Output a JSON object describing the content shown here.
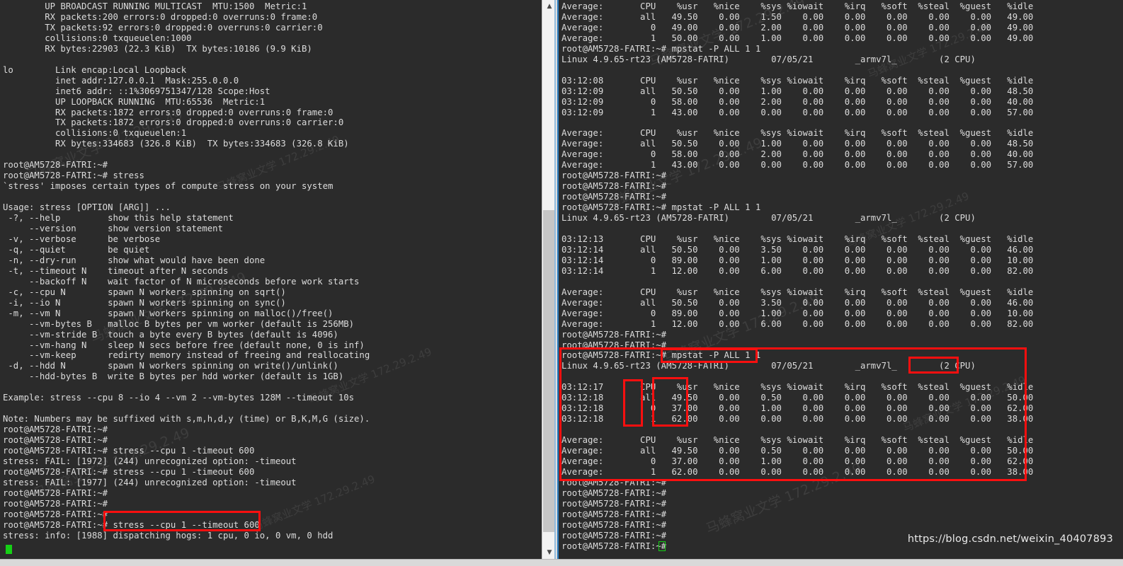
{
  "window": {
    "left_panel_name": "left-terminal",
    "right_panel_name": "right-terminal",
    "background_color": "#2b2b2b",
    "text_color": "#d8d8d8",
    "accent_red": "#fb0f0f",
    "cursor_green": "#16d016"
  },
  "left_terminal": {
    "text": "        UP BROADCAST RUNNING MULTICAST  MTU:1500  Metric:1\n        RX packets:200 errors:0 dropped:0 overruns:0 frame:0\n        TX packets:92 errors:0 dropped:0 overruns:0 carrier:0\n        collisions:0 txqueuelen:1000\n        RX bytes:22903 (22.3 KiB)  TX bytes:10186 (9.9 KiB)\n\nlo        Link encap:Local Loopback\n          inet addr:127.0.0.1  Mask:255.0.0.0\n          inet6 addr: ::1%3069751347/128 Scope:Host\n          UP LOOPBACK RUNNING  MTU:65536  Metric:1\n          RX packets:1872 errors:0 dropped:0 overruns:0 frame:0\n          TX packets:1872 errors:0 dropped:0 overruns:0 carrier:0\n          collisions:0 txqueuelen:1\n          RX bytes:334683 (326.8 KiB)  TX bytes:334683 (326.8 KiB)\n\nroot@AM5728-FATRI:~#\nroot@AM5728-FATRI:~# stress\n`stress' imposes certain types of compute stress on your system\n\nUsage: stress [OPTION [ARG]] ...\n -?, --help         show this help statement\n     --version      show version statement\n -v, --verbose      be verbose\n -q, --quiet        be quiet\n -n, --dry-run      show what would have been done\n -t, --timeout N    timeout after N seconds\n     --backoff N    wait factor of N microseconds before work starts\n -c, --cpu N        spawn N workers spinning on sqrt()\n -i, --io N         spawn N workers spinning on sync()\n -m, --vm N         spawn N workers spinning on malloc()/free()\n     --vm-bytes B   malloc B bytes per vm worker (default is 256MB)\n     --vm-stride B  touch a byte every B bytes (default is 4096)\n     --vm-hang N    sleep N secs before free (default none, 0 is inf)\n     --vm-keep      redirty memory instead of freeing and reallocating\n -d, --hdd N        spawn N workers spinning on write()/unlink()\n     --hdd-bytes B  write B bytes per hdd worker (default is 1GB)\n\nExample: stress --cpu 8 --io 4 --vm 2 --vm-bytes 128M --timeout 10s\n\nNote: Numbers may be suffixed with s,m,h,d,y (time) or B,K,M,G (size).\nroot@AM5728-FATRI:~#\nroot@AM5728-FATRI:~#\nroot@AM5728-FATRI:~# stress --cpu 1 -timeout 600\nstress: FAIL: [1972] (244) unrecognized option: -timeout\nroot@AM5728-FATRI:~# stress --cpu 1 -timeout 600\nstress: FAIL: [1977] (244) unrecognized option: -timeout\nroot@AM5728-FATRI:~#\nroot@AM5728-FATRI:~#\nroot@AM5728-FATRI:~#\nroot@AM5728-FATRI:~# stress --cpu 1 --timeout 600\nstress: info: [1988] dispatching hogs: 1 cpu, 0 io, 0 vm, 0 hdd"
  },
  "right_terminal": {
    "text": "Average:       CPU    %usr   %nice    %sys %iowait    %irq   %soft  %steal  %guest   %idle\nAverage:       all   49.50    0.00    1.50    0.00    0.00    0.00    0.00    0.00   49.00\nAverage:         0   49.00    0.00    2.00    0.00    0.00    0.00    0.00    0.00   49.00\nAverage:         1   50.00    0.00    1.00    0.00    0.00    0.00    0.00    0.00   49.00\nroot@AM5728-FATRI:~# mpstat -P ALL 1 1\nLinux 4.9.65-rt23 (AM5728-FATRI)        07/05/21        _armv7l_        (2 CPU)\n\n03:12:08       CPU    %usr   %nice    %sys %iowait    %irq   %soft  %steal  %guest   %idle\n03:12:09       all   50.50    0.00    1.00    0.00    0.00    0.00    0.00    0.00   48.50\n03:12:09         0   58.00    0.00    2.00    0.00    0.00    0.00    0.00    0.00   40.00\n03:12:09         1   43.00    0.00    0.00    0.00    0.00    0.00    0.00    0.00   57.00\n\nAverage:       CPU    %usr   %nice    %sys %iowait    %irq   %soft  %steal  %guest   %idle\nAverage:       all   50.50    0.00    1.00    0.00    0.00    0.00    0.00    0.00   48.50\nAverage:         0   58.00    0.00    2.00    0.00    0.00    0.00    0.00    0.00   40.00\nAverage:         1   43.00    0.00    0.00    0.00    0.00    0.00    0.00    0.00   57.00\nroot@AM5728-FATRI:~#\nroot@AM5728-FATRI:~#\nroot@AM5728-FATRI:~#\nroot@AM5728-FATRI:~# mpstat -P ALL 1 1\nLinux 4.9.65-rt23 (AM5728-FATRI)        07/05/21        _armv7l_        (2 CPU)\n\n03:12:13       CPU    %usr   %nice    %sys %iowait    %irq   %soft  %steal  %guest   %idle\n03:12:14       all   50.50    0.00    3.50    0.00    0.00    0.00    0.00    0.00   46.00\n03:12:14         0   89.00    0.00    1.00    0.00    0.00    0.00    0.00    0.00   10.00\n03:12:14         1   12.00    0.00    6.00    0.00    0.00    0.00    0.00    0.00   82.00\n\nAverage:       CPU    %usr   %nice    %sys %iowait    %irq   %soft  %steal  %guest   %idle\nAverage:       all   50.50    0.00    3.50    0.00    0.00    0.00    0.00    0.00   46.00\nAverage:         0   89.00    0.00    1.00    0.00    0.00    0.00    0.00    0.00   10.00\nAverage:         1   12.00    0.00    6.00    0.00    0.00    0.00    0.00    0.00   82.00\nroot@AM5728-FATRI:~#\nroot@AM5728-FATRI:~#\nroot@AM5728-FATRI:~# mpstat -P ALL 1 1\nLinux 4.9.65-rt23 (AM5728-FATRI)        07/05/21        _armv7l_        (2 CPU)\n\n03:12:17       CPU    %usr   %nice    %sys %iowait    %irq   %soft  %steal  %guest   %idle\n03:12:18       all   49.50    0.00    0.50    0.00    0.00    0.00    0.00    0.00   50.00\n03:12:18         0   37.00    0.00    1.00    0.00    0.00    0.00    0.00    0.00   62.00\n03:12:18         1   62.00    0.00    0.00    0.00    0.00    0.00    0.00    0.00   38.00\n\nAverage:       CPU    %usr   %nice    %sys %iowait    %irq   %soft  %steal  %guest   %idle\nAverage:       all   49.50    0.00    0.50    0.00    0.00    0.00    0.00    0.00   50.00\nAverage:         0   37.00    0.00    1.00    0.00    0.00    0.00    0.00    0.00   62.00\nAverage:         1   62.00    0.00    0.00    0.00    0.00    0.00    0.00    0.00   38.00\nroot@AM5728-FATRI:~#\nroot@AM5728-FATRI:~#\nroot@AM5728-FATRI:~#\nroot@AM5728-FATRI:~#\nroot@AM5728-FATRI:~#\nroot@AM5728-FATRI:~#\nroot@AM5728-FATRI:~# "
  },
  "annotations": {
    "box_left_command": "stress --cpu 1 --timeout 600",
    "box_right_command": "mpstat -P ALL 1 1",
    "box_cpu_count": "(2 CPU)",
    "box_cpu_column": "CPU",
    "box_usr_column": "%usr",
    "box_outer_region": "mpstat output block"
  },
  "scrollbar": {
    "up_arrow": "▲",
    "down_arrow": "▼"
  },
  "footer": {
    "blog_url": "https://blog.csdn.net/weixin_40407893"
  },
  "watermarks": [
    "马蜂窝业文学 172.29.2.49",
    "马蜂窝业文学 172.29.2.49",
    "马蜂窝业文学 172.29.2.49"
  ]
}
